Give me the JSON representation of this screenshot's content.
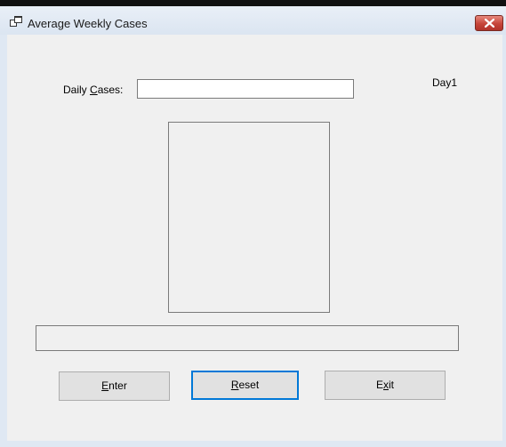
{
  "window": {
    "title": "Average Weekly Cases",
    "close_icon": "close-icon"
  },
  "form": {
    "daily_cases_label_pre": "Daily ",
    "daily_cases_label_mnemonic": "C",
    "daily_cases_label_post": "ases:",
    "daily_cases_value": "",
    "day_label": "Day1",
    "cases_list_items": [],
    "result_text": ""
  },
  "buttons": {
    "enter": {
      "mnemonic": "E",
      "rest": "nter"
    },
    "reset": {
      "mnemonic": "R",
      "rest": "eset"
    },
    "exit": {
      "pre": "E",
      "mnemonic": "x",
      "rest": "it"
    }
  },
  "colors": {
    "title_bar": "#dfe8f3",
    "close_button": "#c6453a",
    "form_background": "#f0f0f0",
    "focus_border": "#0078d7"
  }
}
